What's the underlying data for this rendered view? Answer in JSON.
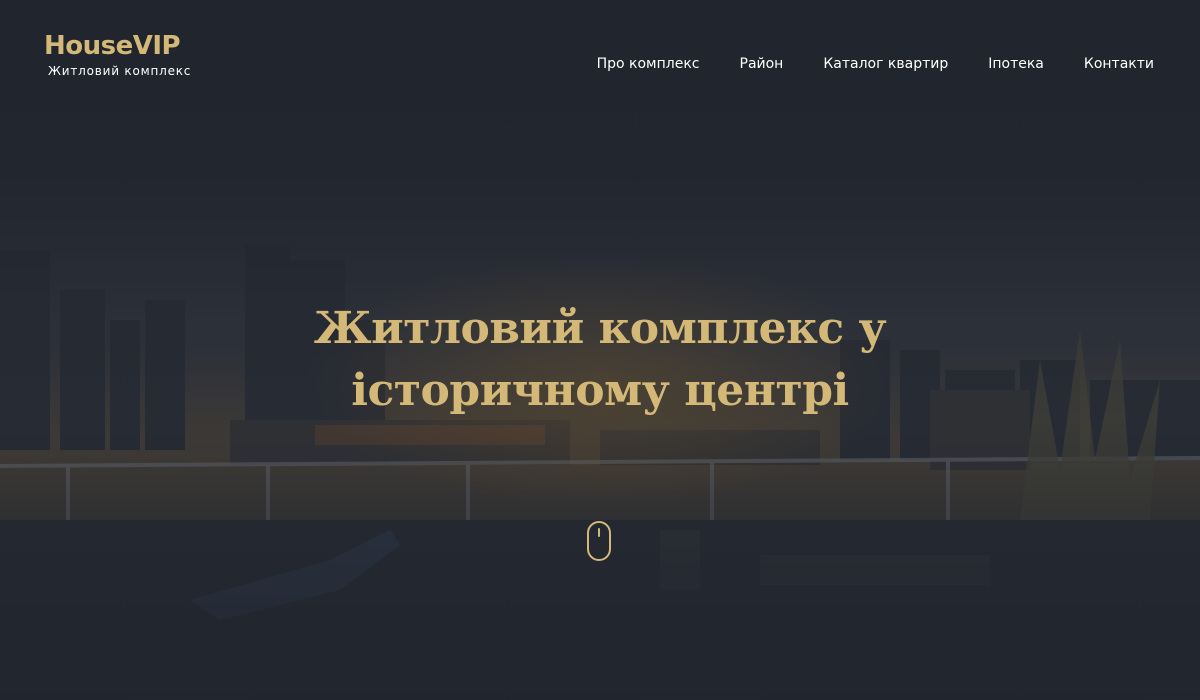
{
  "logo": {
    "name": "HouseVIP",
    "subtitle": "Житловий комплекс"
  },
  "nav": {
    "items": [
      {
        "label": "Про комплекс"
      },
      {
        "label": "Район"
      },
      {
        "label": "Каталог квартир"
      },
      {
        "label": "Іпотека"
      },
      {
        "label": "Контакти"
      }
    ]
  },
  "hero": {
    "title_line1": "Житловий комплекс у",
    "title_line2": "історичному центрі",
    "scroll_icon": "mouse-scroll-icon"
  },
  "colors": {
    "accent": "#d4b877",
    "background": "#222731",
    "nav_text": "#ffffff"
  }
}
